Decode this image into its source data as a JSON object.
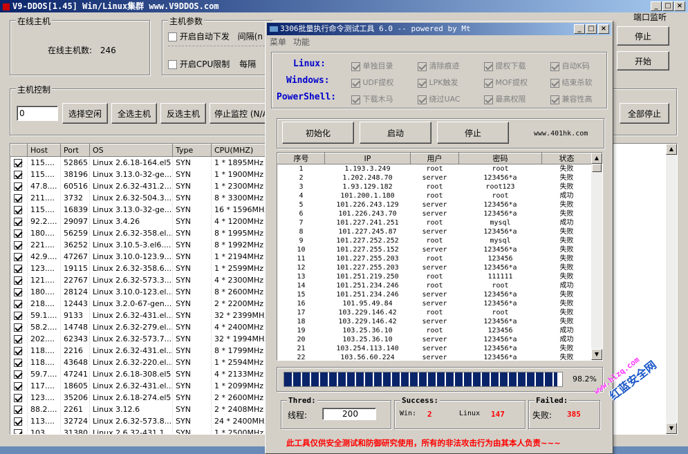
{
  "main": {
    "title": "V9-DDOS[1.45] Win/Linux集群 www.V9DDOS.com",
    "online_group": "在线主机",
    "online_label": "在线主机数:",
    "online_count": "246",
    "params_group": "主机参数",
    "auto_dispatch": "开启自动下发",
    "interval_label": "间隔(n",
    "cpu_limit": "开启CPU限制",
    "every_label": "每隔",
    "port_monitor_partial": "端口监听",
    "stop_btn": "停止",
    "start_btn": "开始",
    "control_group": "主机控制",
    "count_input": "0",
    "select_idle": "选择空闲",
    "select_all": "全选主机",
    "invert_select": "反选主机",
    "stop_monitor": "停止监控 (N/A",
    "stop_all": "全部停止",
    "columns": [
      "Host",
      "Port",
      "OS",
      "Type",
      "CPU(MHZ)"
    ],
    "rows": [
      [
        "115....",
        "52865",
        "Linux 2.6.18-164.el5",
        "SYN",
        "1 * 1895MHz"
      ],
      [
        "115....",
        "38196",
        "Linux 3.13.0-32-ge...",
        "SYN",
        "1 * 1900MHz"
      ],
      [
        "47.8....",
        "60516",
        "Linux 2.6.32-431.2...",
        "SYN",
        "1 * 2300MHz"
      ],
      [
        "211....",
        "3732",
        "Linux 2.6.32-504.3...",
        "SYN",
        "8 * 3300MHz"
      ],
      [
        "115....",
        "16839",
        "Linux 3.13.0-32-ge...",
        "SYN",
        "16 * 1596MHz"
      ],
      [
        "92.2....",
        "29097",
        "Linux 3.4.26",
        "SYN",
        "4 * 1200MHz"
      ],
      [
        "180....",
        "56259",
        "Linux 2.6.32-358.el...",
        "SYN",
        "8 * 1995MHz"
      ],
      [
        "221....",
        "36252",
        "Linux 3.10.5-3.el6....",
        "SYN",
        "8 * 1992MHz"
      ],
      [
        "42.9....",
        "47267",
        "Linux 3.10.0-123.9....",
        "SYN",
        "1 * 2194MHz"
      ],
      [
        "123....",
        "19115",
        "Linux 2.6.32-358.6....",
        "SYN",
        "1 * 2599MHz"
      ],
      [
        "121....",
        "22767",
        "Linux 2.6.32-573.3....",
        "SYN",
        "4 * 2300MHz"
      ],
      [
        "180....",
        "28124",
        "Linux 3.10.0-123.el...",
        "SYN",
        "8 * 2600MHz"
      ],
      [
        "218....",
        "12443",
        "Linux 3.2.0-67-gen...",
        "SYN",
        "2 * 2200MHz"
      ],
      [
        "59.1....",
        "9133",
        "Linux 2.6.32-431.el...",
        "SYN",
        "32 * 2399MHz"
      ],
      [
        "58.2....",
        "14748",
        "Linux 2.6.32-279.el...",
        "SYN",
        "4 * 2400MHz"
      ],
      [
        "202....",
        "62343",
        "Linux 2.6.32-573.7....",
        "SYN",
        "32 * 1994MHz"
      ],
      [
        "118....",
        "2216",
        "Linux 2.6.32-431.el...",
        "SYN",
        "8 * 1799MHz"
      ],
      [
        "118....",
        "43648",
        "Linux 2.6.32-220.el...",
        "SYN",
        "1 * 2594MHz"
      ],
      [
        "59.7....",
        "47241",
        "Linux 2.6.18-308.el5",
        "SYN",
        "4 * 2133MHz"
      ],
      [
        "117....",
        "18605",
        "Linux 2.6.32-431.el...",
        "SYN",
        "1 * 2099MHz"
      ],
      [
        "123....",
        "35206",
        "Linux 2.6.18-274.el5",
        "SYN",
        "2 * 2600MHz"
      ],
      [
        "88.2....",
        "2261",
        "Linux 3.12.6",
        "SYN",
        "2 * 2408MHz"
      ],
      [
        "113....",
        "32724",
        "Linux 2.6.32-573.8....",
        "SYN",
        "24 * 2400MHz"
      ],
      [
        "103....",
        "31380",
        "Linux 2.6.32-431.1...",
        "SYN",
        "1 * 2500MHz"
      ]
    ]
  },
  "tool": {
    "title": "3306批量执行命令测试工具 6.0 -- powered by Mt",
    "menu": [
      "菜单",
      "功能"
    ],
    "os_linux": "Linux:",
    "os_windows": "Windows:",
    "os_ps": "PowerShell:",
    "opts": [
      [
        "单独目录",
        "清除痕迹",
        "提权下载",
        "自动K码"
      ],
      [
        "UDF提权",
        "LPK触发",
        "MOF提权",
        "结束杀软"
      ],
      [
        "下载木马",
        "绕过UAC",
        "最高权限",
        "兼容性高"
      ]
    ],
    "init_btn": "初始化",
    "start_btn": "启动",
    "stop_btn": "停止",
    "site": "www.401hk.com",
    "cols": [
      "序号",
      "IP",
      "用户",
      "密码",
      "状态"
    ],
    "rows": [
      [
        "1",
        "1.193.3.249",
        "root",
        "root",
        "失败"
      ],
      [
        "2",
        "1.202.248.70",
        "server",
        "123456*a",
        "失败"
      ],
      [
        "3",
        "1.93.129.182",
        "root",
        "root123",
        "失败"
      ],
      [
        "4",
        "101.200.1.180",
        "root",
        "root",
        "成功"
      ],
      [
        "5",
        "101.226.243.129",
        "server",
        "123456*a",
        "失败"
      ],
      [
        "6",
        "101.226.243.70",
        "server",
        "123456*a",
        "失败"
      ],
      [
        "7",
        "101.227.241.251",
        "root",
        "mysql",
        "成功"
      ],
      [
        "8",
        "101.227.245.87",
        "server",
        "123456*a",
        "失败"
      ],
      [
        "9",
        "101.227.252.252",
        "root",
        "mysql",
        "失败"
      ],
      [
        "10",
        "101.227.255.152",
        "server",
        "123456*a",
        "失败"
      ],
      [
        "11",
        "101.227.255.203",
        "root",
        "123456",
        "失败"
      ],
      [
        "12",
        "101.227.255.203",
        "server",
        "123456*a",
        "失败"
      ],
      [
        "13",
        "101.251.219.250",
        "root",
        "111111",
        "失败"
      ],
      [
        "14",
        "101.251.234.246",
        "root",
        "root",
        "成功"
      ],
      [
        "15",
        "101.251.234.246",
        "server",
        "123456*a",
        "失败"
      ],
      [
        "16",
        "101.95.49.84",
        "server",
        "123456*a",
        "失败"
      ],
      [
        "17",
        "103.229.146.42",
        "root",
        "root",
        "失败"
      ],
      [
        "18",
        "103.229.146.42",
        "server",
        "123456*a",
        "失败"
      ],
      [
        "19",
        "103.25.36.10",
        "root",
        "123456",
        "成功"
      ],
      [
        "20",
        "103.25.36.10",
        "server",
        "123456*a",
        "成功"
      ],
      [
        "21",
        "103.254.113.140",
        "server",
        "123456*a",
        "失败"
      ],
      [
        "22",
        "103.56.60.224",
        "server",
        "123456*a",
        "失败"
      ]
    ],
    "progress_pct": 98.2,
    "progress_text": "98.2%",
    "thread_group": "Thred:",
    "thread_label": "线程:",
    "thread_value": "200",
    "success_group": "Success:",
    "win_label": "Win:",
    "win_count": "2",
    "linux_label": "Linux",
    "linux_count": "147",
    "failed_group": "Failed:",
    "fail_label": "失败:",
    "fail_count": "385",
    "disclaimer": "此工具仅供安全测试和防御研究使用，所有的非法攻击行为由其本人负责~~~"
  },
  "watermark": {
    "text": "红蓝安全网",
    "url": "www.hlzq.com"
  },
  "colors": {
    "title_bar": "#0a246a",
    "progress": "#0a246a",
    "red_text": "#ff0000",
    "blue_text": "#0000cc"
  }
}
